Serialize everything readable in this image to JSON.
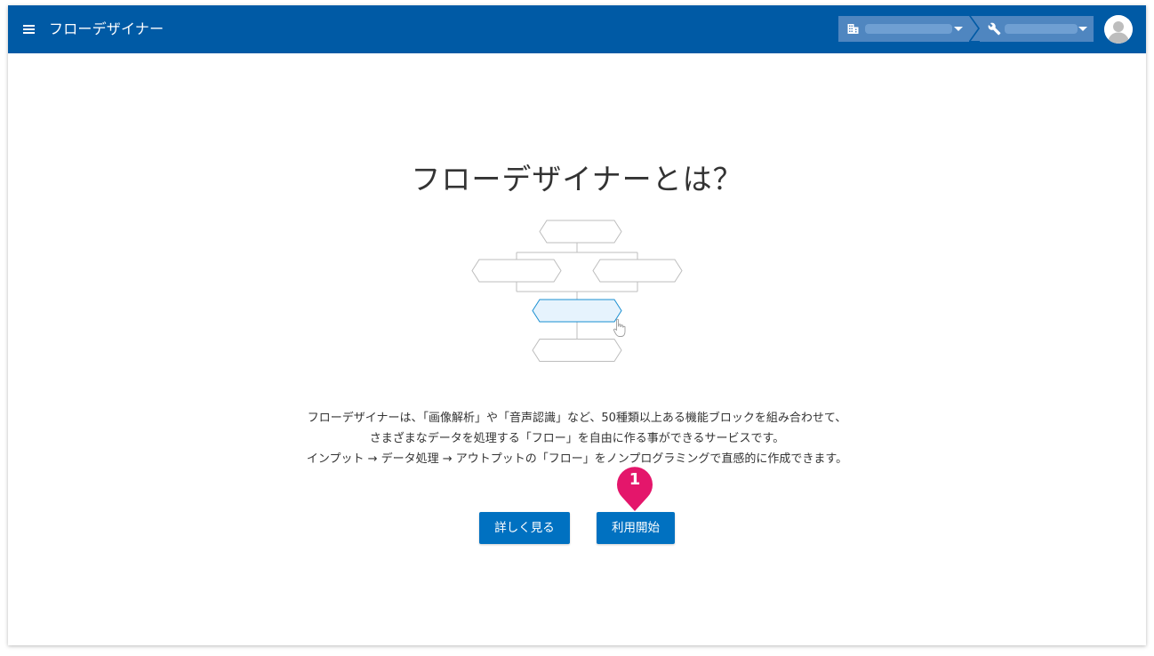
{
  "appbar": {
    "title": "フローデザイナー",
    "org_selector": {
      "value": ""
    },
    "tool_selector": {
      "value": ""
    }
  },
  "intro": {
    "heading": "フローデザイナーとは？",
    "description": [
      "フローデザイナーは、「画像解析」や「音声認識」など、50種類以上ある機能ブロックを組み合わせて、",
      "さまざまなデータを処理する「フロー」を自由に作る事ができるサービスです。",
      "インプット → データ処理 → アウトプットの「フロー」をノンプログラミングで直感的に作成できます。"
    ]
  },
  "actions": {
    "more_label": "詳しく見る",
    "start_label": "利用開始"
  },
  "callout": {
    "number": "1"
  },
  "icons": {
    "menu": "hamburger-menu-icon",
    "org": "building-icon",
    "tool": "wrench-icon",
    "avatar": "user-avatar-icon",
    "pointer": "hand-pointer-icon"
  },
  "colors": {
    "appbar": "#005aa5",
    "selector": "#4f86c0",
    "button": "#0071c1",
    "callout": "#e4166b",
    "highlight_block": "#e6f3fd",
    "highlight_border": "#1a8fd1"
  }
}
